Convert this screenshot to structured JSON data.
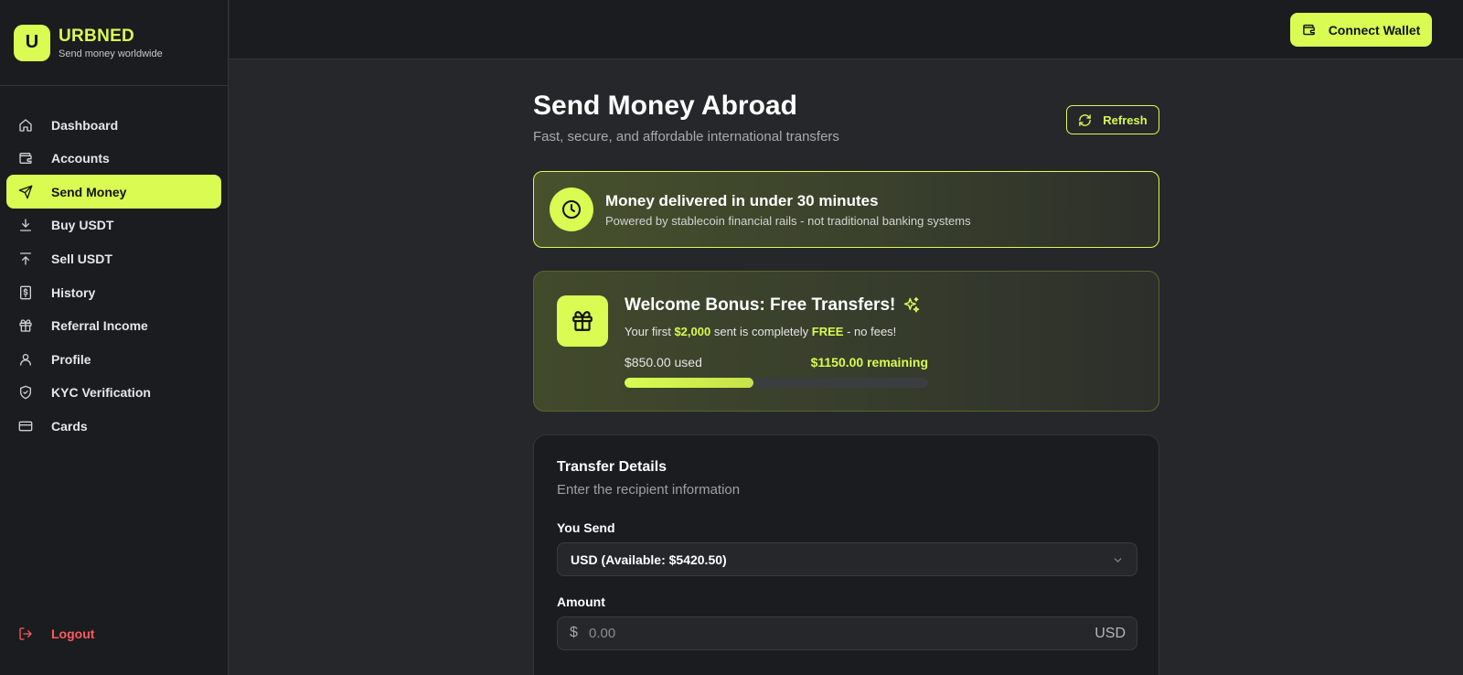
{
  "brand": {
    "logo_letter": "U",
    "name": "URBNED",
    "tagline": "Send money worldwide"
  },
  "sidebar": {
    "items": [
      {
        "label": "Dashboard",
        "icon": "home-icon",
        "active": false
      },
      {
        "label": "Accounts",
        "icon": "wallet-icon",
        "active": false
      },
      {
        "label": "Send Money",
        "icon": "send-icon",
        "active": true
      },
      {
        "label": "Buy USDT",
        "icon": "download-icon",
        "active": false
      },
      {
        "label": "Sell USDT",
        "icon": "upload-icon",
        "active": false
      },
      {
        "label": "History",
        "icon": "receipt-icon",
        "active": false
      },
      {
        "label": "Referral Income",
        "icon": "gift-icon",
        "active": false
      },
      {
        "label": "Profile",
        "icon": "user-icon",
        "active": false
      },
      {
        "label": "KYC Verification",
        "icon": "shield-icon",
        "active": false
      },
      {
        "label": "Cards",
        "icon": "credit-card-icon",
        "active": false
      }
    ],
    "logout_label": "Logout"
  },
  "topbar": {
    "connect_wallet_label": "Connect Wallet"
  },
  "main": {
    "title": "Send Money Abroad",
    "subtitle": "Fast, secure, and affordable international transfers",
    "refresh_label": "Refresh",
    "banner": {
      "title": "Money delivered in under 30 minutes",
      "subtitle": "Powered by stablecoin financial rails - not traditional banking systems"
    },
    "bonus": {
      "title": "Welcome Bonus: Free Transfers!",
      "desc_prefix": "Your first",
      "desc_amount": "$2,000",
      "desc_middle": "sent is completely",
      "desc_free": "FREE",
      "desc_suffix": "- no fees!",
      "used": "$850.00 used",
      "remaining": "$1150.00 remaining",
      "progress_fraction": 0.425
    },
    "transfer": {
      "title": "Transfer Details",
      "subtitle": "Enter the recipient information",
      "you_send_label": "You Send",
      "you_send_value": "USD (Available: $5420.50)",
      "amount_label": "Amount",
      "amount_symbol": "$",
      "amount_placeholder": "0.00",
      "amount_currency": "USD"
    }
  },
  "colors": {
    "accent": "#d9fb52",
    "background": "#26272b",
    "panel": "#1b1c1f",
    "danger": "#ff5a5f"
  }
}
